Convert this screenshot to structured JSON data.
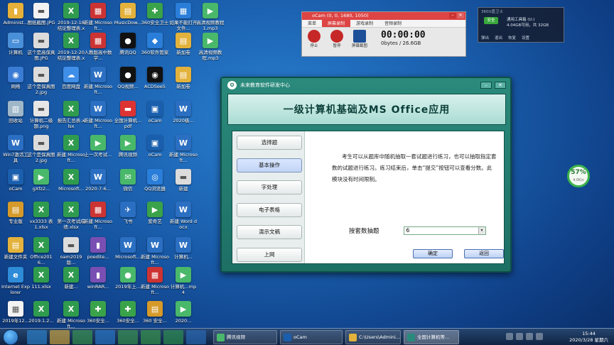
{
  "desktop": {
    "icons": [
      {
        "label": "Administ...",
        "color": "#e6b13a",
        "glyph": "▮"
      },
      {
        "label": "计算机",
        "color": "#4a90d9",
        "glyph": "▭"
      },
      {
        "label": "网络",
        "color": "#3a7bd5",
        "glyph": "◉"
      },
      {
        "label": "回收站",
        "color": "#9fb7c9",
        "glyph": "▥"
      },
      {
        "label": "Win7激活工具",
        "color": "#2b6fc2",
        "glyph": "W"
      },
      {
        "label": "oCam",
        "color": "#1a5fae",
        "glyph": "▣"
      },
      {
        "label": "专业版",
        "color": "#d69a2a",
        "glyph": "▤"
      },
      {
        "label": "新建文件夹",
        "color": "#e3b23c",
        "glyph": "▤"
      },
      {
        "label": "Internet Explorer",
        "color": "#2e8bd8",
        "glyph": "e"
      },
      {
        "label": "2019年12...",
        "color": "#f3f3f3",
        "glyph": "▦"
      },
      {
        "label": "图纸截图.JPG",
        "color": "#f2f2f2",
        "glyph": "▬"
      },
      {
        "label": "这个是高保真图.JPG",
        "color": "#dcdcdc",
        "glyph": "▬"
      },
      {
        "label": "这个是保真图2.jpg",
        "color": "#dcdcdc",
        "glyph": "▬"
      },
      {
        "label": "计算机二级题.png",
        "color": "#e6e6e6",
        "glyph": "▬"
      },
      {
        "label": "这个是保真图2.jpg",
        "color": "#dcdcdc",
        "glyph": "▬"
      },
      {
        "label": "gXfz2... ",
        "color": "#49b86a",
        "glyph": "▶"
      },
      {
        "label": "vx3333 表 1.xlsx",
        "color": "#2f9b4e",
        "glyph": "X"
      },
      {
        "label": "Office2016... ",
        "color": "#2f9b4e",
        "glyph": "X"
      },
      {
        "label": "111.xlsx",
        "color": "#2f9b4e",
        "glyph": "X"
      },
      {
        "label": "2019.1.2...",
        "color": "#2f9b4e",
        "glyph": "X"
      },
      {
        "label": "2019-12-18 结论整理表.xlsx",
        "color": "#2f9b4e",
        "glyph": "X"
      },
      {
        "label": "2019-12-20 结论整理表.xlsx",
        "color": "#2f9b4e",
        "glyph": "X"
      },
      {
        "label": "百度网盘",
        "color": "#3f8ee8",
        "glyph": "☁"
      },
      {
        "label": "报告汇总表.xlsx",
        "color": "#2f9b4e",
        "glyph": "X"
      },
      {
        "label": "新建 Microsoft...",
        "color": "#2f9b4e",
        "glyph": "X"
      },
      {
        "label": "Microsoft...",
        "color": "#2f9b4e",
        "glyph": "X"
      },
      {
        "label": "第一次考试成绩.xlsx",
        "color": "#2f9b4e",
        "glyph": "X"
      },
      {
        "label": "oam2019版...",
        "color": "#dcdcdc",
        "glyph": "▬"
      },
      {
        "label": "新建...",
        "color": "#2f9b4e",
        "glyph": "X"
      },
      {
        "label": "新建 Microsoft...",
        "color": "#2f9b4e",
        "glyph": "X"
      },
      {
        "label": "新建 Microsoft...",
        "color": "#c33",
        "glyph": "▦"
      },
      {
        "label": "人教版高中数学...",
        "color": "#c33",
        "glyph": "▦"
      },
      {
        "label": "新建 Microsoft...",
        "color": "#2b6fc2",
        "glyph": "W"
      },
      {
        "label": "新建 Microsoft...",
        "color": "#2b6fc2",
        "glyph": "W"
      },
      {
        "label": "上一次考试...",
        "color": "#49b86a",
        "glyph": "▶"
      },
      {
        "label": "2020-7-6...",
        "color": "#2b6fc2",
        "glyph": "W"
      },
      {
        "label": "新建 Microsoft...",
        "color": "#c33",
        "glyph": "▦"
      },
      {
        "label": "poedite...",
        "color": "#7a4fb3",
        "glyph": "▮"
      },
      {
        "label": "winRAR...",
        "color": "#7a4fb3",
        "glyph": "▮"
      },
      {
        "label": "360安全...",
        "color": "#3aa34a",
        "glyph": "✚"
      },
      {
        "label": "MusicDow...",
        "color": "#e3b23c",
        "glyph": "▤"
      },
      {
        "label": "腾讯QQ",
        "color": "#111",
        "glyph": "●"
      },
      {
        "label": "QQ视频...",
        "color": "#111",
        "glyph": "●"
      },
      {
        "label": "全国计算机...pdf",
        "color": "#d33",
        "glyph": "▬"
      },
      {
        "label": "腾讯视频",
        "color": "#49b86a",
        "glyph": "▶"
      },
      {
        "label": "微信",
        "color": "#49b86a",
        "glyph": "✉"
      },
      {
        "label": "飞书",
        "color": "#2b6fc2",
        "glyph": "✈"
      },
      {
        "label": "Microsoft...",
        "color": "#2b6fc2",
        "glyph": "W"
      },
      {
        "label": "2019年上...",
        "color": "#49b86a",
        "glyph": "●"
      },
      {
        "label": "360安全...",
        "color": "#3aa34a",
        "glyph": "✚"
      },
      {
        "label": "360安全卫士",
        "color": "#3aa34a",
        "glyph": "✚"
      },
      {
        "label": "360软件管家",
        "color": "#2a7ed9",
        "glyph": "◆"
      },
      {
        "label": "ACDSee5",
        "color": "#111",
        "glyph": "◉"
      },
      {
        "label": "oCam",
        "color": "#1a5fae",
        "glyph": "▣"
      },
      {
        "label": "oCam",
        "color": "#1a5fae",
        "glyph": "▣"
      },
      {
        "label": "QQ浏览器",
        "color": "#2a7ed9",
        "glyph": "◎"
      },
      {
        "label": "爱奇艺",
        "color": "#3aa34a",
        "glyph": "▶"
      },
      {
        "label": "新建 Microsoft...",
        "color": "#2b6fc2",
        "glyph": "W"
      },
      {
        "label": "新建 Microsoft...",
        "color": "#c33",
        "glyph": "▦"
      },
      {
        "label": "360 安全...",
        "color": "#d69a2a",
        "glyph": "▤"
      },
      {
        "label": "如果不能打开文件...",
        "color": "#2a7ed9",
        "glyph": "▦"
      },
      {
        "label": "新加卷",
        "color": "#e3b23c",
        "glyph": "▤"
      },
      {
        "label": "新加卷",
        "color": "#e3b23c",
        "glyph": "▤"
      },
      {
        "label": "2020级...",
        "color": "#2b6fc2",
        "glyph": "W"
      },
      {
        "label": "新建 Microsoft...",
        "color": "#2b6fc2",
        "glyph": "W"
      },
      {
        "label": "新建",
        "color": "#dcdcdc",
        "glyph": "▬"
      },
      {
        "label": "新建 Word docx",
        "color": "#2b6fc2",
        "glyph": "W"
      },
      {
        "label": "计算机...",
        "color": "#2b6fc2",
        "glyph": "W"
      },
      {
        "label": "计算机...mp4",
        "color": "#49b86a",
        "glyph": "▶"
      },
      {
        "label": "2020...",
        "color": "#49b86a",
        "glyph": "▶"
      },
      {
        "label": "高清视频教程1.mp3",
        "color": "#49b86a",
        "glyph": "▶"
      },
      {
        "label": "高清视频教程.mp3",
        "color": "#49b86a",
        "glyph": "▶"
      }
    ]
  },
  "ocam": {
    "title": "oCam (0, 0, 1680, 1050)",
    "menu": [
      "菜单",
      "屏幕录制",
      "游戏录制",
      "音频录制"
    ],
    "active_menu": "屏幕录制",
    "tools": [
      {
        "label": "停止",
        "color": "#c62828"
      },
      {
        "label": "暂停",
        "color": "#c62828"
      },
      {
        "label": "屏幕截图",
        "color": "#1e4f99"
      }
    ],
    "time": "00:00:00",
    "size": "0bytes / 26.6GB"
  },
  "widget360": {
    "header": "360U盘卫士",
    "safe": "安全",
    "line1": "通用工具箱 (U:)",
    "line2": "4.04GB可用，共 32GB",
    "footer": [
      "弹出",
      "退出",
      "恢复",
      "设置"
    ]
  },
  "percent_widget": {
    "value": "57%",
    "caption": "4.0K/s"
  },
  "main_window": {
    "title": "未来教育软件研发中心",
    "banner": "一级计算机基础及MS Office应用",
    "nav": [
      "选择题",
      "基本操作",
      "字处理",
      "电子表格",
      "演示文稿",
      "上网"
    ],
    "active_nav": "基本操作",
    "description": "考生可以从题库中随机抽取一套试题进行练习，也可以抽取指定套数的试题进行练习。练习结束后，单击“提交”按钮可以查看分数。此模块没有时间限制。",
    "select_label": "按套数抽题",
    "select_value": "6",
    "confirm_label": "确定",
    "back_label": "返回"
  },
  "taskbar": {
    "tasks": [
      {
        "label": "腾讯视频",
        "color": "#49b86a"
      },
      {
        "label": "oCam",
        "color": "#1a5fae"
      },
      {
        "label": "C:\\Users\\Admini...",
        "color": "#e3b23c"
      },
      {
        "label": "全国计算机等...",
        "color": "#2a8a7c"
      }
    ],
    "time": "15:44",
    "date": "2020/3/28 星期六"
  }
}
